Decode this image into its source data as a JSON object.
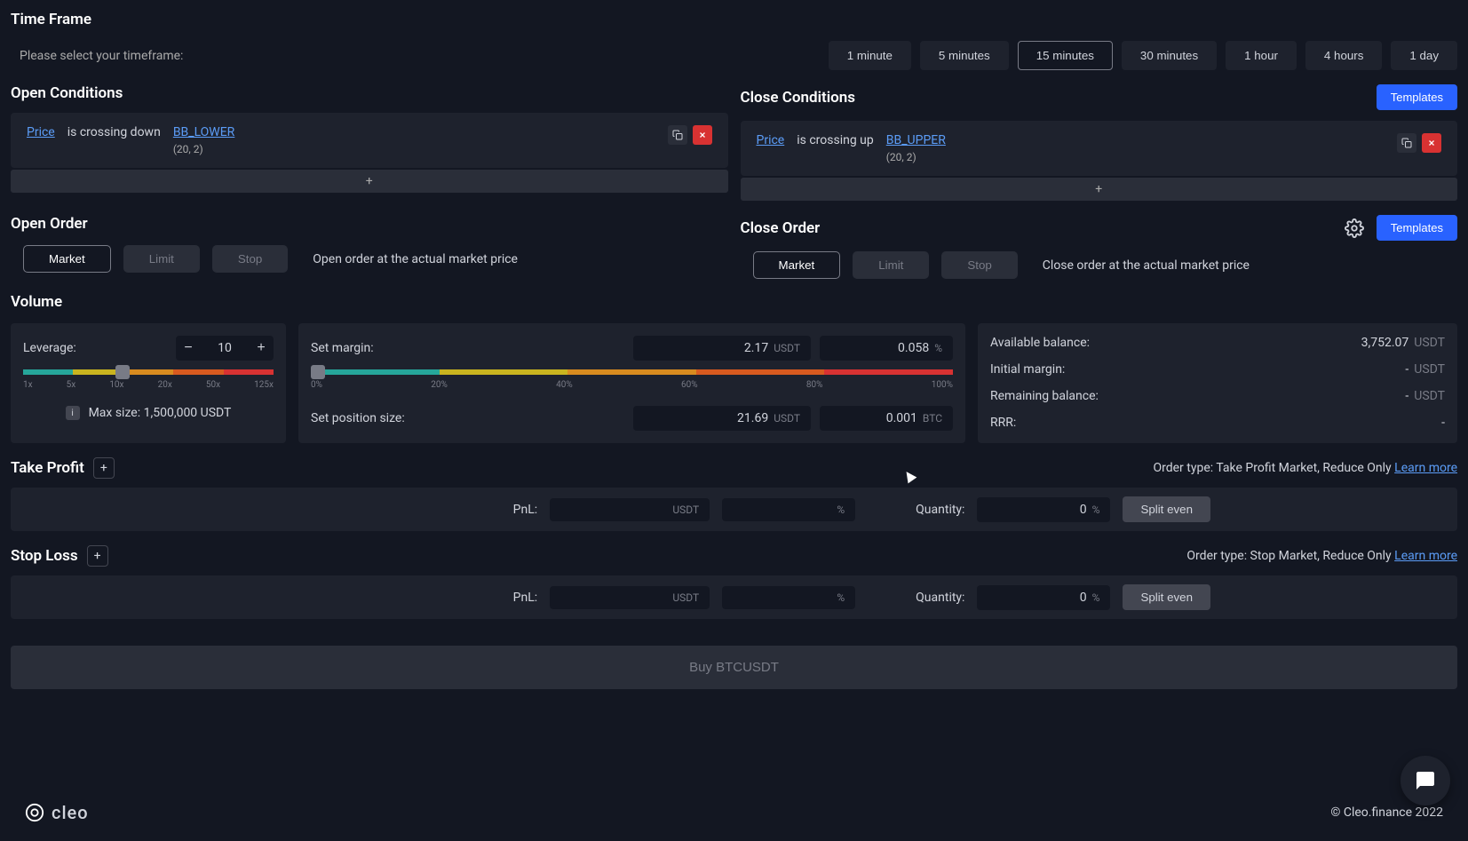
{
  "timeframe": {
    "title": "Time Frame",
    "prompt": "Please select your timeframe:",
    "options": [
      "1 minute",
      "5 minutes",
      "15 minutes",
      "30 minutes",
      "1 hour",
      "4 hours",
      "1 day"
    ],
    "selected": "15 minutes"
  },
  "open_conditions": {
    "title": "Open Conditions",
    "subject": "Price",
    "relation": "is crossing down",
    "indicator": "BB_LOWER",
    "params": "(20, 2)"
  },
  "close_conditions": {
    "title": "Close Conditions",
    "templates_label": "Templates",
    "subject": "Price",
    "relation": "is crossing up",
    "indicator": "BB_UPPER",
    "params": "(20, 2)"
  },
  "open_order": {
    "title": "Open Order",
    "tabs": [
      "Market",
      "Limit",
      "Stop"
    ],
    "selected": "Market",
    "hint": "Open order at the actual market price"
  },
  "close_order": {
    "title": "Close Order",
    "templates_label": "Templates",
    "tabs": [
      "Market",
      "Limit",
      "Stop"
    ],
    "selected": "Market",
    "hint": "Close order at the actual market price"
  },
  "volume": {
    "title": "Volume",
    "leverage_label": "Leverage:",
    "leverage_value": "10",
    "leverage_ticks": [
      "1x",
      "5x",
      "10x",
      "20x",
      "50x",
      "125x"
    ],
    "max_size_label": "Max size: 1,500,000 USDT",
    "set_margin_label": "Set margin:",
    "margin_value": "2.17",
    "margin_unit": "USDT",
    "margin_pct": "0.058",
    "margin_pct_unit": "%",
    "margin_ticks": [
      "0%",
      "20%",
      "40%",
      "60%",
      "80%",
      "100%"
    ],
    "set_position_label": "Set position size:",
    "position_value": "21.69",
    "position_unit": "USDT",
    "position_btc": "0.001",
    "position_btc_unit": "BTC",
    "balances": {
      "available_label": "Available balance:",
      "available_value": "3,752.07",
      "available_unit": "USDT",
      "initial_label": "Initial margin:",
      "initial_value": "-",
      "initial_unit": "USDT",
      "remaining_label": "Remaining balance:",
      "remaining_value": "-",
      "remaining_unit": "USDT",
      "rrr_label": "RRR:",
      "rrr_value": "-"
    }
  },
  "take_profit": {
    "title": "Take Profit",
    "order_type_text": "Order type: Take Profit Market, Reduce Only",
    "learn_more": "Learn more",
    "pnl_label": "PnL:",
    "pnl_unit": "USDT",
    "pct_unit": "%",
    "quantity_label": "Quantity:",
    "quantity_value": "0",
    "quantity_unit": "%",
    "split_label": "Split even"
  },
  "stop_loss": {
    "title": "Stop Loss",
    "order_type_text": "Order type: Stop Market, Reduce Only",
    "learn_more": "Learn more",
    "pnl_label": "PnL:",
    "pnl_unit": "USDT",
    "pct_unit": "%",
    "quantity_label": "Quantity:",
    "quantity_value": "0",
    "quantity_unit": "%",
    "split_label": "Split even"
  },
  "buy_button": "Buy BTCUSDT",
  "footer": {
    "brand": "cleo",
    "copyright": "© Cleo.finance 2022"
  }
}
